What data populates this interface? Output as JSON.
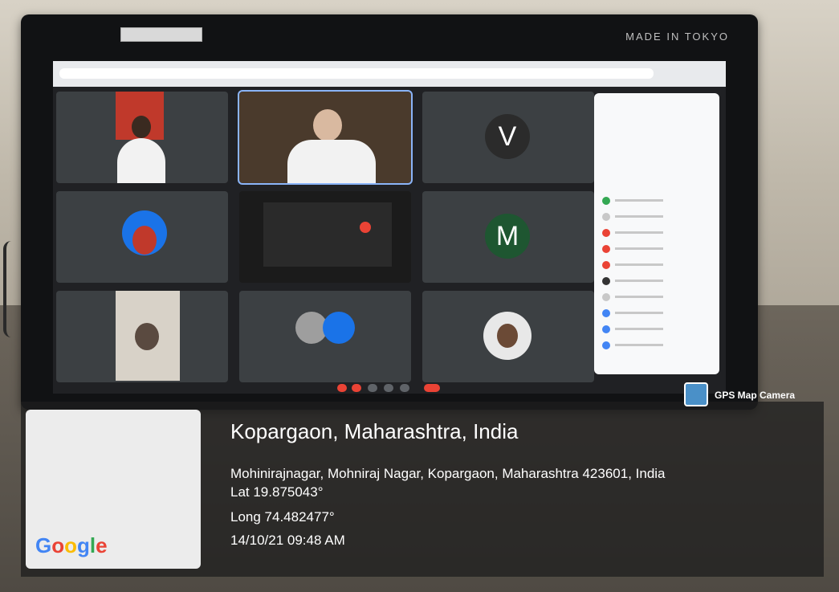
{
  "monitor": {
    "brand": "MADE IN TOKYO"
  },
  "meeting": {
    "tiles": [
      {
        "id": "t1",
        "type": "photo",
        "name": ""
      },
      {
        "id": "t2",
        "type": "photo",
        "name": ""
      },
      {
        "id": "t3",
        "type": "letter",
        "letter": "V",
        "color": "#3c4043",
        "name": ""
      },
      {
        "id": "t4",
        "type": "photo-round",
        "name": ""
      },
      {
        "id": "t5",
        "type": "screen",
        "name": ""
      },
      {
        "id": "t6",
        "type": "letter",
        "letter": "M",
        "color": "#1e5631",
        "name": ""
      },
      {
        "id": "t7",
        "type": "photo",
        "name": ""
      },
      {
        "id": "t8",
        "type": "duo",
        "name": ""
      },
      {
        "id": "t9",
        "type": "photo-round",
        "name": ""
      }
    ],
    "participant_dot_colors": [
      "#34a853",
      "#c8c8c8",
      "#ea4335",
      "#ea4335",
      "#ea4335",
      "#333333",
      "#c8c8c8",
      "#4285f4",
      "#4285f4",
      "#4285f4"
    ]
  },
  "gps": {
    "app_name": "GPS Map Camera",
    "location_title": "Kopargaon, Maharashtra, India",
    "address": "Mohinirajnagar, Mohniraj Nagar, Kopargaon, Maharashtra 423601, India",
    "lat": "Lat 19.875043°",
    "long": "Long 74.482477°",
    "datetime": "14/10/21 09:48 AM",
    "map_provider_letters": [
      "G",
      "o",
      "o",
      "g",
      "l",
      "e"
    ],
    "map_provider_colors": [
      "#4285f4",
      "#ea4335",
      "#fbbc05",
      "#4285f4",
      "#34a853",
      "#ea4335"
    ]
  }
}
